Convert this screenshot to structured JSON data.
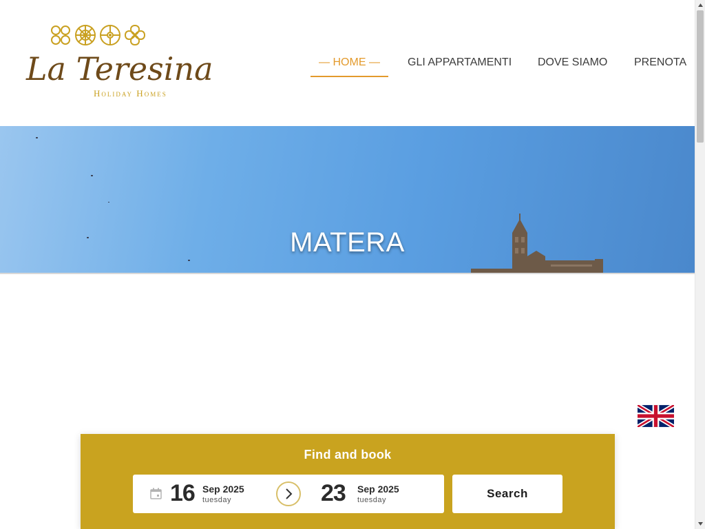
{
  "brand": {
    "name": "La Teresina",
    "tagline": "Holiday Homes",
    "colors": {
      "gold": "#c9a31f",
      "brown": "#6e4a1a",
      "accent": "#e39a2c"
    }
  },
  "nav": {
    "items": [
      {
        "label": "— HOME —",
        "active": true
      },
      {
        "label": "GLI APPARTAMENTI",
        "active": false
      },
      {
        "label": "DOVE SIAMO",
        "active": false
      },
      {
        "label": "PRENOTA",
        "active": false
      }
    ]
  },
  "hero": {
    "title": "MATERA"
  },
  "language": {
    "flag_icon": "uk-flag-icon"
  },
  "booking": {
    "title": "Find and book",
    "checkin": {
      "day": "16",
      "month_year": "Sep 2025",
      "weekday": "tuesday"
    },
    "checkout": {
      "day": "23",
      "month_year": "Sep 2025",
      "weekday": "tuesday"
    },
    "calendar_icon": "calendar-icon",
    "arrow_icon": "chevron-right-icon",
    "search_label": "Search"
  }
}
